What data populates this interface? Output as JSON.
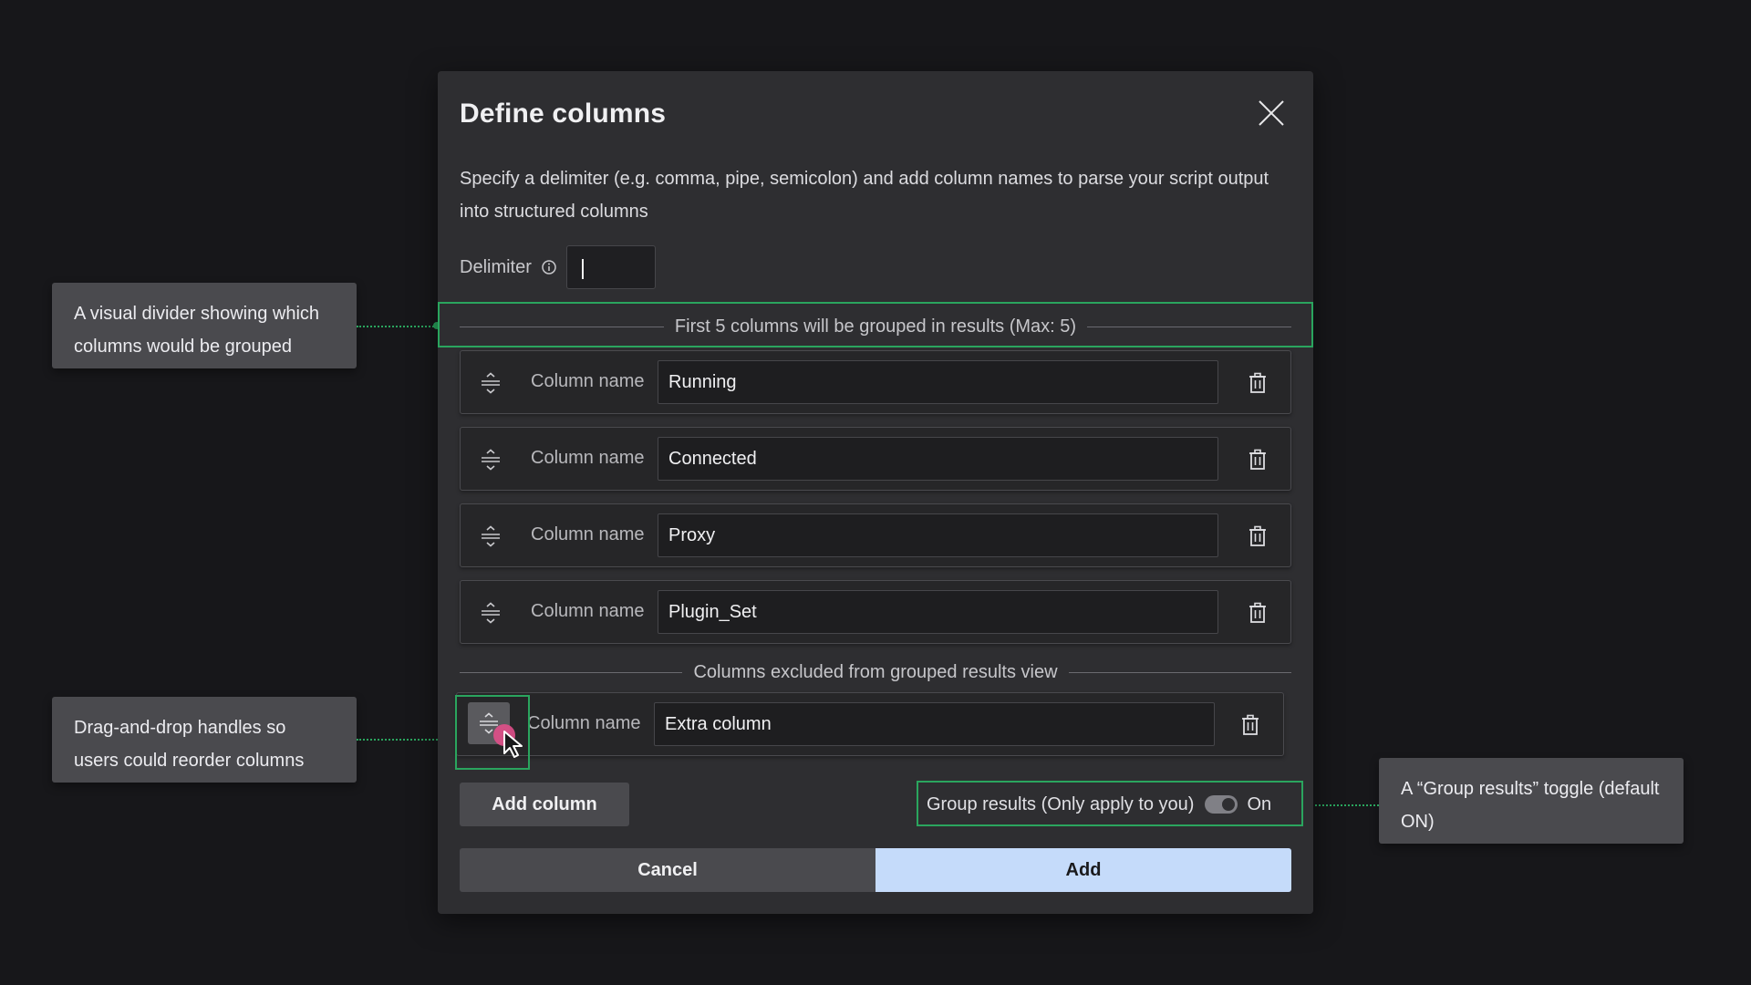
{
  "modal": {
    "title": "Define columns",
    "description": "Specify a delimiter (e.g. comma, pipe, semicolon) and add column names to parse your script output into structured columns",
    "delimiter_label": "Delimiter",
    "delimiter_value": "",
    "grouped_divider_text": "First 5 columns will be grouped in results (Max: 5)",
    "excluded_divider_text": "Columns excluded from grouped results view",
    "column_label": "Column name",
    "columns": [
      {
        "value": "Running"
      },
      {
        "value": "Connected"
      },
      {
        "value": "Proxy"
      },
      {
        "value": "Plugin_Set"
      }
    ],
    "excluded_columns": [
      {
        "value": "Extra column"
      }
    ],
    "add_column_label": "Add column",
    "group_results_label": "Group results (Only apply to you)",
    "group_results_state": "On",
    "cancel_label": "Cancel",
    "add_label": "Add"
  },
  "annotations": {
    "divider_note": "A visual divider showing which columns would be grouped",
    "drag_note": "Drag-and-drop handles so users could reorder columns",
    "toggle_note": "A “Group results” toggle (default ON)"
  },
  "colors": {
    "background": "#17171a",
    "modal": "#2e2e31",
    "highlight": "#2aa55e",
    "primary_button": "#c5dbfa",
    "cursor_dot": "#e04f8a"
  },
  "icons": [
    "close-icon",
    "info-icon",
    "drag-handle-icon",
    "trash-icon",
    "cursor-arrow-icon"
  ]
}
